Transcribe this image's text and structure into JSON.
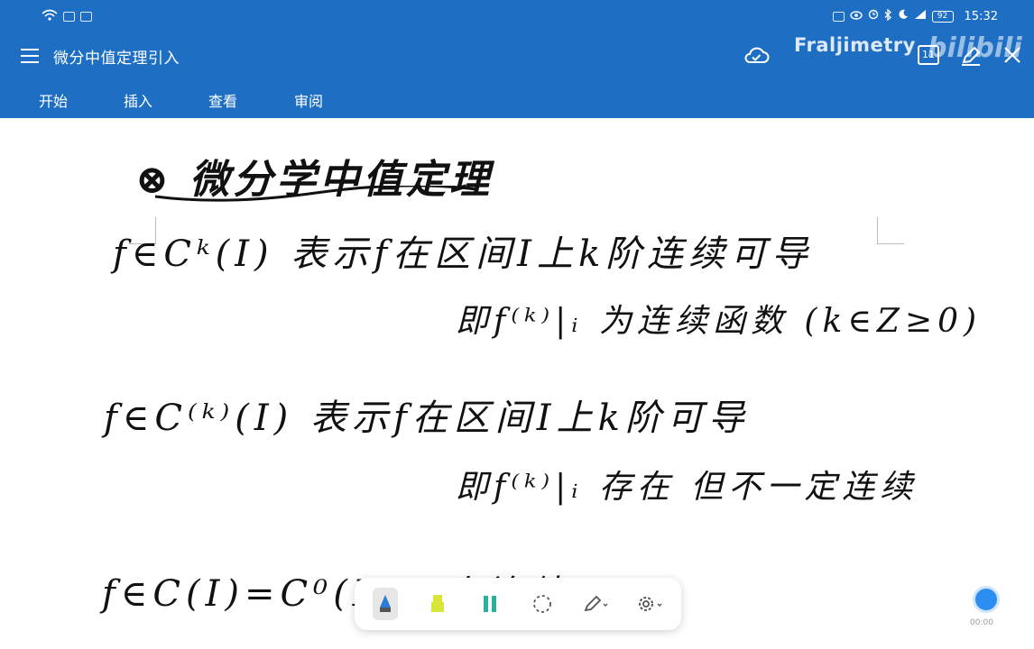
{
  "status": {
    "time": "15:32",
    "battery": "92"
  },
  "app": {
    "title": "微分中值定理引入",
    "watermark": "Fraljimetry",
    "watermark_brand": "bilibili",
    "pages_count": "11"
  },
  "ribbon": {
    "tabs": [
      "开始",
      "插入",
      "查看",
      "审阅"
    ]
  },
  "notes": {
    "heading": "⊗ 微分学中值定理",
    "line1": "f∈Cᵏ(I) 表示f在区间I上k阶连续可导",
    "line2": "即f⁽ᵏ⁾|ᵢ 为连续函数 (k∈Z≥0)",
    "line3": "f∈C⁽ᵏ⁾(I) 表示f在区间I上k阶可导",
    "line4": "即f⁽ᵏ⁾|ᵢ 存在 但不一定连续",
    "line5": "f∈C(I)=C⁰(I)= 上连续"
  },
  "fab": {
    "label": "00:00"
  },
  "colors": {
    "primary": "#1e6fc4",
    "canvas": "#ffffff",
    "ink": "#111111"
  }
}
